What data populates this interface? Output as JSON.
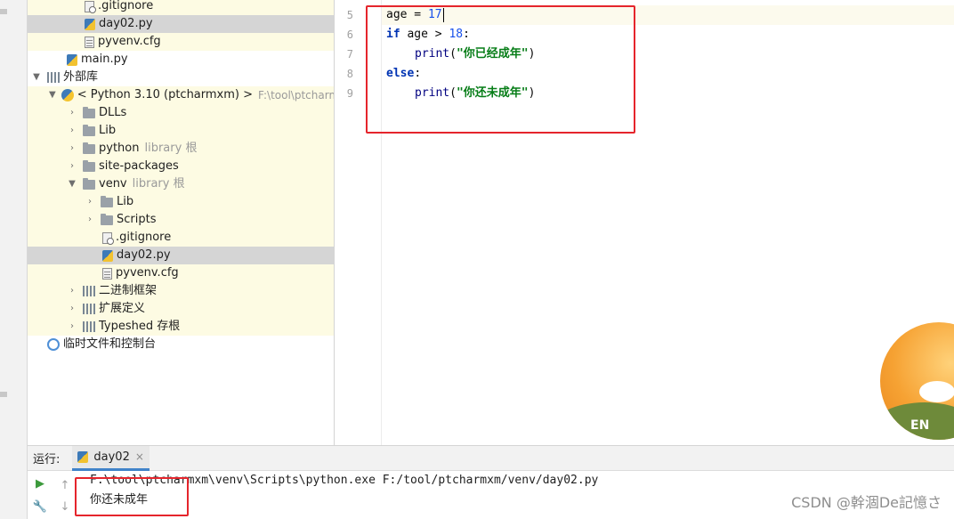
{
  "tree": {
    "items": [
      {
        "label": ".gitignore",
        "icon": "gitignore-file-icon"
      },
      {
        "label": "day02.py",
        "icon": "python-file-icon"
      },
      {
        "label": "pyvenv.cfg",
        "icon": "config-file-icon"
      },
      {
        "label": "main.py",
        "icon": "python-file-icon"
      },
      {
        "label": "外部库",
        "icon": "library-icon"
      },
      {
        "label": "< Python 3.10 (ptcharmxm) >",
        "path": "F:\\tool\\ptcharmxm",
        "icon": "python-sdk-icon"
      },
      {
        "label": "DLLs",
        "icon": "folder-icon"
      },
      {
        "label": "Lib",
        "icon": "folder-icon"
      },
      {
        "label": "python",
        "suffix": "library 根",
        "icon": "folder-icon"
      },
      {
        "label": "site-packages",
        "icon": "folder-icon"
      },
      {
        "label": "venv",
        "suffix": "library 根",
        "icon": "folder-icon"
      },
      {
        "label": "Lib",
        "icon": "folder-icon"
      },
      {
        "label": "Scripts",
        "icon": "folder-icon"
      },
      {
        "label": ".gitignore",
        "icon": "gitignore-file-icon"
      },
      {
        "label": "day02.py",
        "icon": "python-file-icon"
      },
      {
        "label": "pyvenv.cfg",
        "icon": "config-file-icon"
      },
      {
        "label": "二进制框架",
        "icon": "library-icon"
      },
      {
        "label": "扩展定义",
        "icon": "library-icon"
      },
      {
        "label": "Typeshed 存根",
        "icon": "library-icon"
      },
      {
        "label": "临时文件和控制台",
        "icon": "scratches-icon"
      }
    ]
  },
  "editor": {
    "line_numbers": [
      "5",
      "6",
      "7",
      "8",
      "9"
    ],
    "lines": [
      {
        "t1": "age = ",
        "t2": "17"
      },
      {
        "kw": "if",
        "t1": " age > ",
        "num": "18",
        "t2": ":"
      },
      {
        "fn": "print",
        "t1": "(",
        "str": "\"你已经成年\"",
        "t2": ")"
      },
      {
        "kw": "else",
        "t2": ":"
      },
      {
        "fn": "print",
        "t1": "(",
        "str": "\"你还未成年\"",
        "t2": ")"
      }
    ]
  },
  "run": {
    "label": "运行:",
    "tab": "day02",
    "tab_close": "×",
    "command": "F:\\tool\\ptcharmxm\\venv\\Scripts\\python.exe F:/tool/ptcharmxm/venv/day02.py",
    "output": "你还未成年"
  },
  "avatar": {
    "text": "EN"
  },
  "watermark": "CSDN @幹涸De記憶さ",
  "colors": {
    "highlight_box": "#e5252c",
    "tab_accent": "#4083c9",
    "yellow_row": "#fdfbe3"
  }
}
